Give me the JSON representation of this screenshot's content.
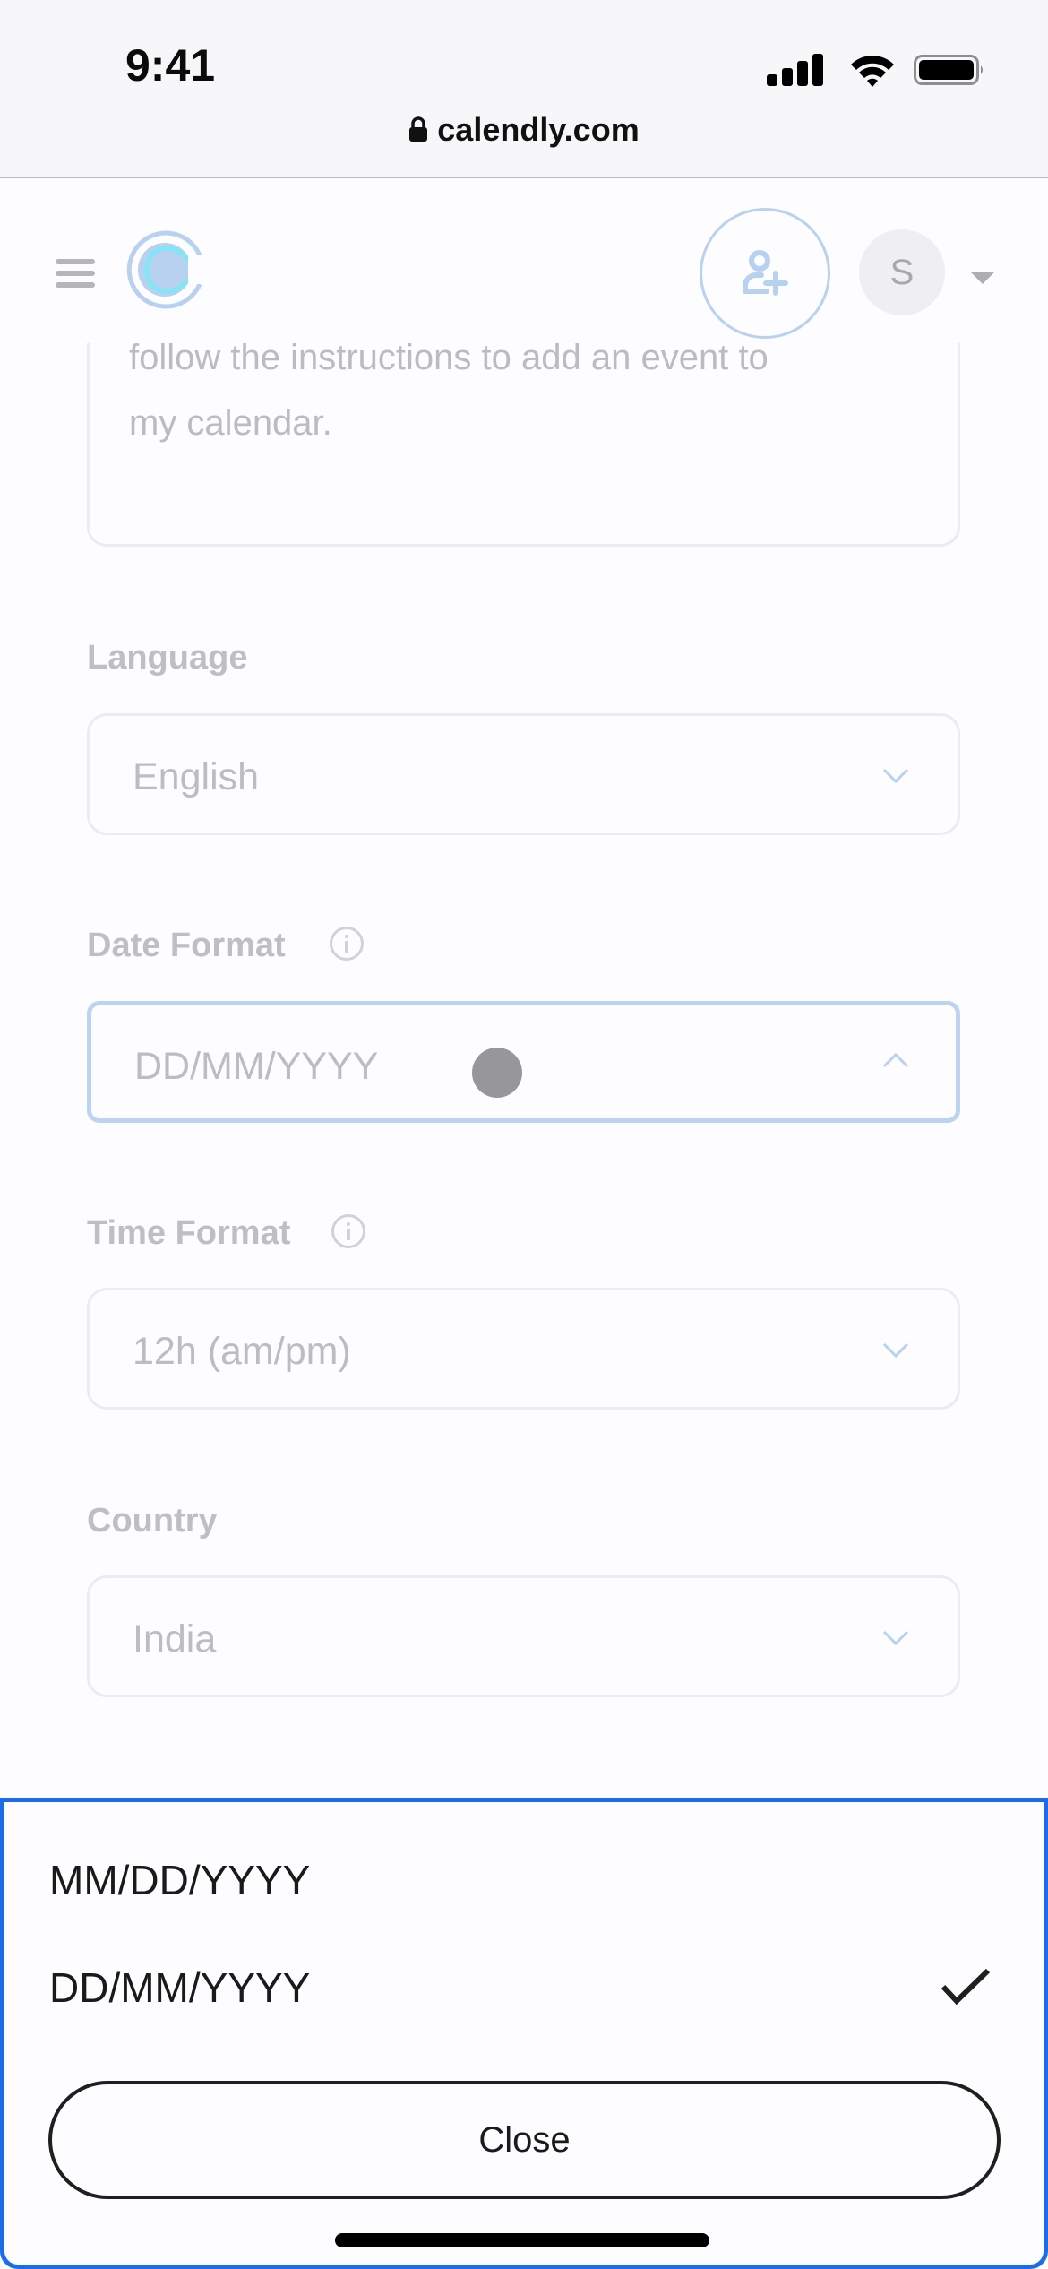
{
  "status_bar": {
    "time": "9:41",
    "icons": [
      "cellular-signal-icon",
      "wifi-icon",
      "battery-icon"
    ]
  },
  "browser": {
    "url": "calendly.com",
    "lock_icon": "lock-icon"
  },
  "header": {
    "menu_icon": "hamburger-icon",
    "logo": "calendly-logo",
    "invite_icon": "add-user-icon",
    "avatar_initial": "S",
    "avatar_menu_icon": "caret-down-icon"
  },
  "form": {
    "textarea_lines": [
      "follow the instructions to add an event to",
      "my calendar."
    ],
    "fields": [
      {
        "label": "Language",
        "value": "English",
        "has_info": false,
        "open": false
      },
      {
        "label": "Date Format",
        "value": "DD/MM/YYYY",
        "has_info": true,
        "open": true
      },
      {
        "label": "Time Format",
        "value": "12h (am/pm)",
        "has_info": true,
        "open": false
      },
      {
        "label": "Country",
        "value": "India",
        "has_info": false,
        "open": false
      }
    ]
  },
  "picker_sheet": {
    "options": [
      {
        "label": "MM/DD/YYYY",
        "selected": false
      },
      {
        "label": "DD/MM/YYYY",
        "selected": true
      }
    ],
    "close_label": "Close"
  },
  "colors": {
    "accent_blue": "#1a6de6",
    "focus_border": "#bcd4f2",
    "logo_blue": "#b9d1f1",
    "label_gray": "#bfbec2"
  }
}
